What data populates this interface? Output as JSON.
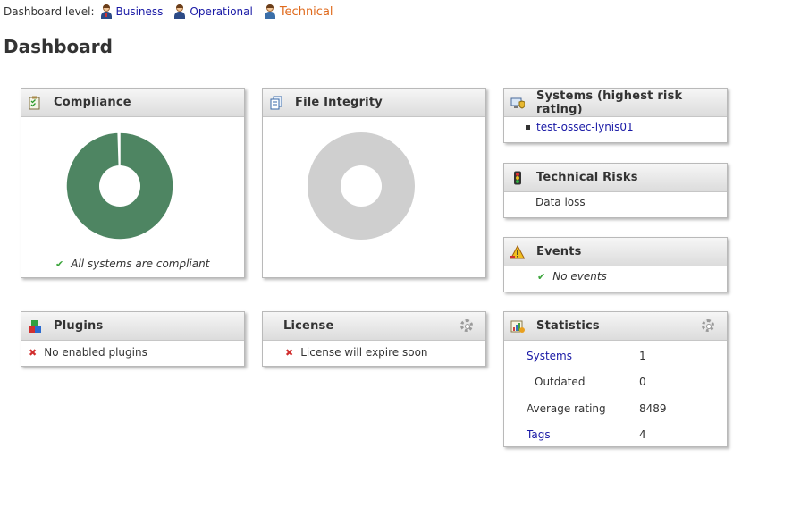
{
  "level_bar": {
    "label": "Dashboard level:",
    "levels": [
      {
        "label": "Business",
        "icon": "business-person-icon"
      },
      {
        "label": "Operational",
        "icon": "operational-person-icon"
      },
      {
        "label": "Technical",
        "icon": "technical-person-icon",
        "active": true
      }
    ]
  },
  "page_title": "Dashboard",
  "compliance": {
    "title": "Compliance",
    "icon": "clipboard-checklist-icon",
    "donut": {
      "compliant_fraction": 0.995,
      "color": "#4e8562",
      "hole_color": "#ffffff"
    },
    "status_text": "All systems are compliant"
  },
  "file_integrity": {
    "title": "File Integrity",
    "icon": "documents-icon",
    "donut": {
      "empty_color": "#cfcfcf"
    }
  },
  "systems_risk": {
    "title": "Systems (highest risk rating)",
    "icon": "computer-shield-icon",
    "items": [
      "test-ossec-lynis01"
    ]
  },
  "technical_risks": {
    "title": "Technical Risks",
    "icon": "traffic-light-icon",
    "items": [
      "Data loss"
    ]
  },
  "events": {
    "title": "Events",
    "icon": "warning-triangle-icon",
    "status_text": "No events"
  },
  "plugins": {
    "title": "Plugins",
    "icon": "blocks-icon",
    "status_text": "No enabled plugins"
  },
  "license": {
    "title": "License",
    "icon": "license-icon",
    "status_text": "License will expire soon"
  },
  "statistics": {
    "title": "Statistics",
    "icon": "statistics-chart-icon",
    "rows": [
      {
        "label": "Systems",
        "value": "1",
        "link": true
      },
      {
        "label": "Outdated",
        "value": "0",
        "sub": true
      },
      {
        "label": "Average rating",
        "value": "8489"
      },
      {
        "label": "Tags",
        "value": "4",
        "link": true
      }
    ]
  },
  "colors": {
    "link": "#1a1aa6",
    "active_level": "#e06a1c",
    "check": "#3aa43a",
    "cross": "#d12e2e"
  }
}
